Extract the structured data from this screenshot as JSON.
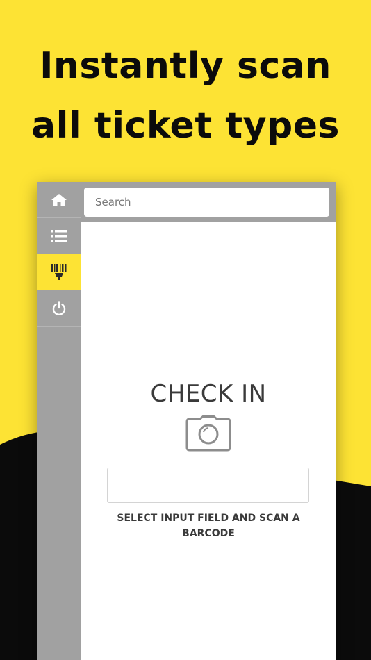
{
  "headline": {
    "line1": "Instantly scan",
    "line2": "all ticket types"
  },
  "colors": {
    "background": "#fde334",
    "wave": "#0b0b0b",
    "sidebar": "#a1a1a1",
    "active_item": "#fde334"
  },
  "sidebar": {
    "items": [
      {
        "icon": "home-icon",
        "active": false
      },
      {
        "icon": "list-icon",
        "active": false
      },
      {
        "icon": "barcode-scanner-icon",
        "active": true
      },
      {
        "icon": "power-icon",
        "active": false
      }
    ]
  },
  "search": {
    "placeholder": "Search"
  },
  "checkin": {
    "title": "CHECK IN",
    "icon": "camera-icon",
    "instruction": "SELECT INPUT FIELD AND SCAN A BARCODE"
  }
}
